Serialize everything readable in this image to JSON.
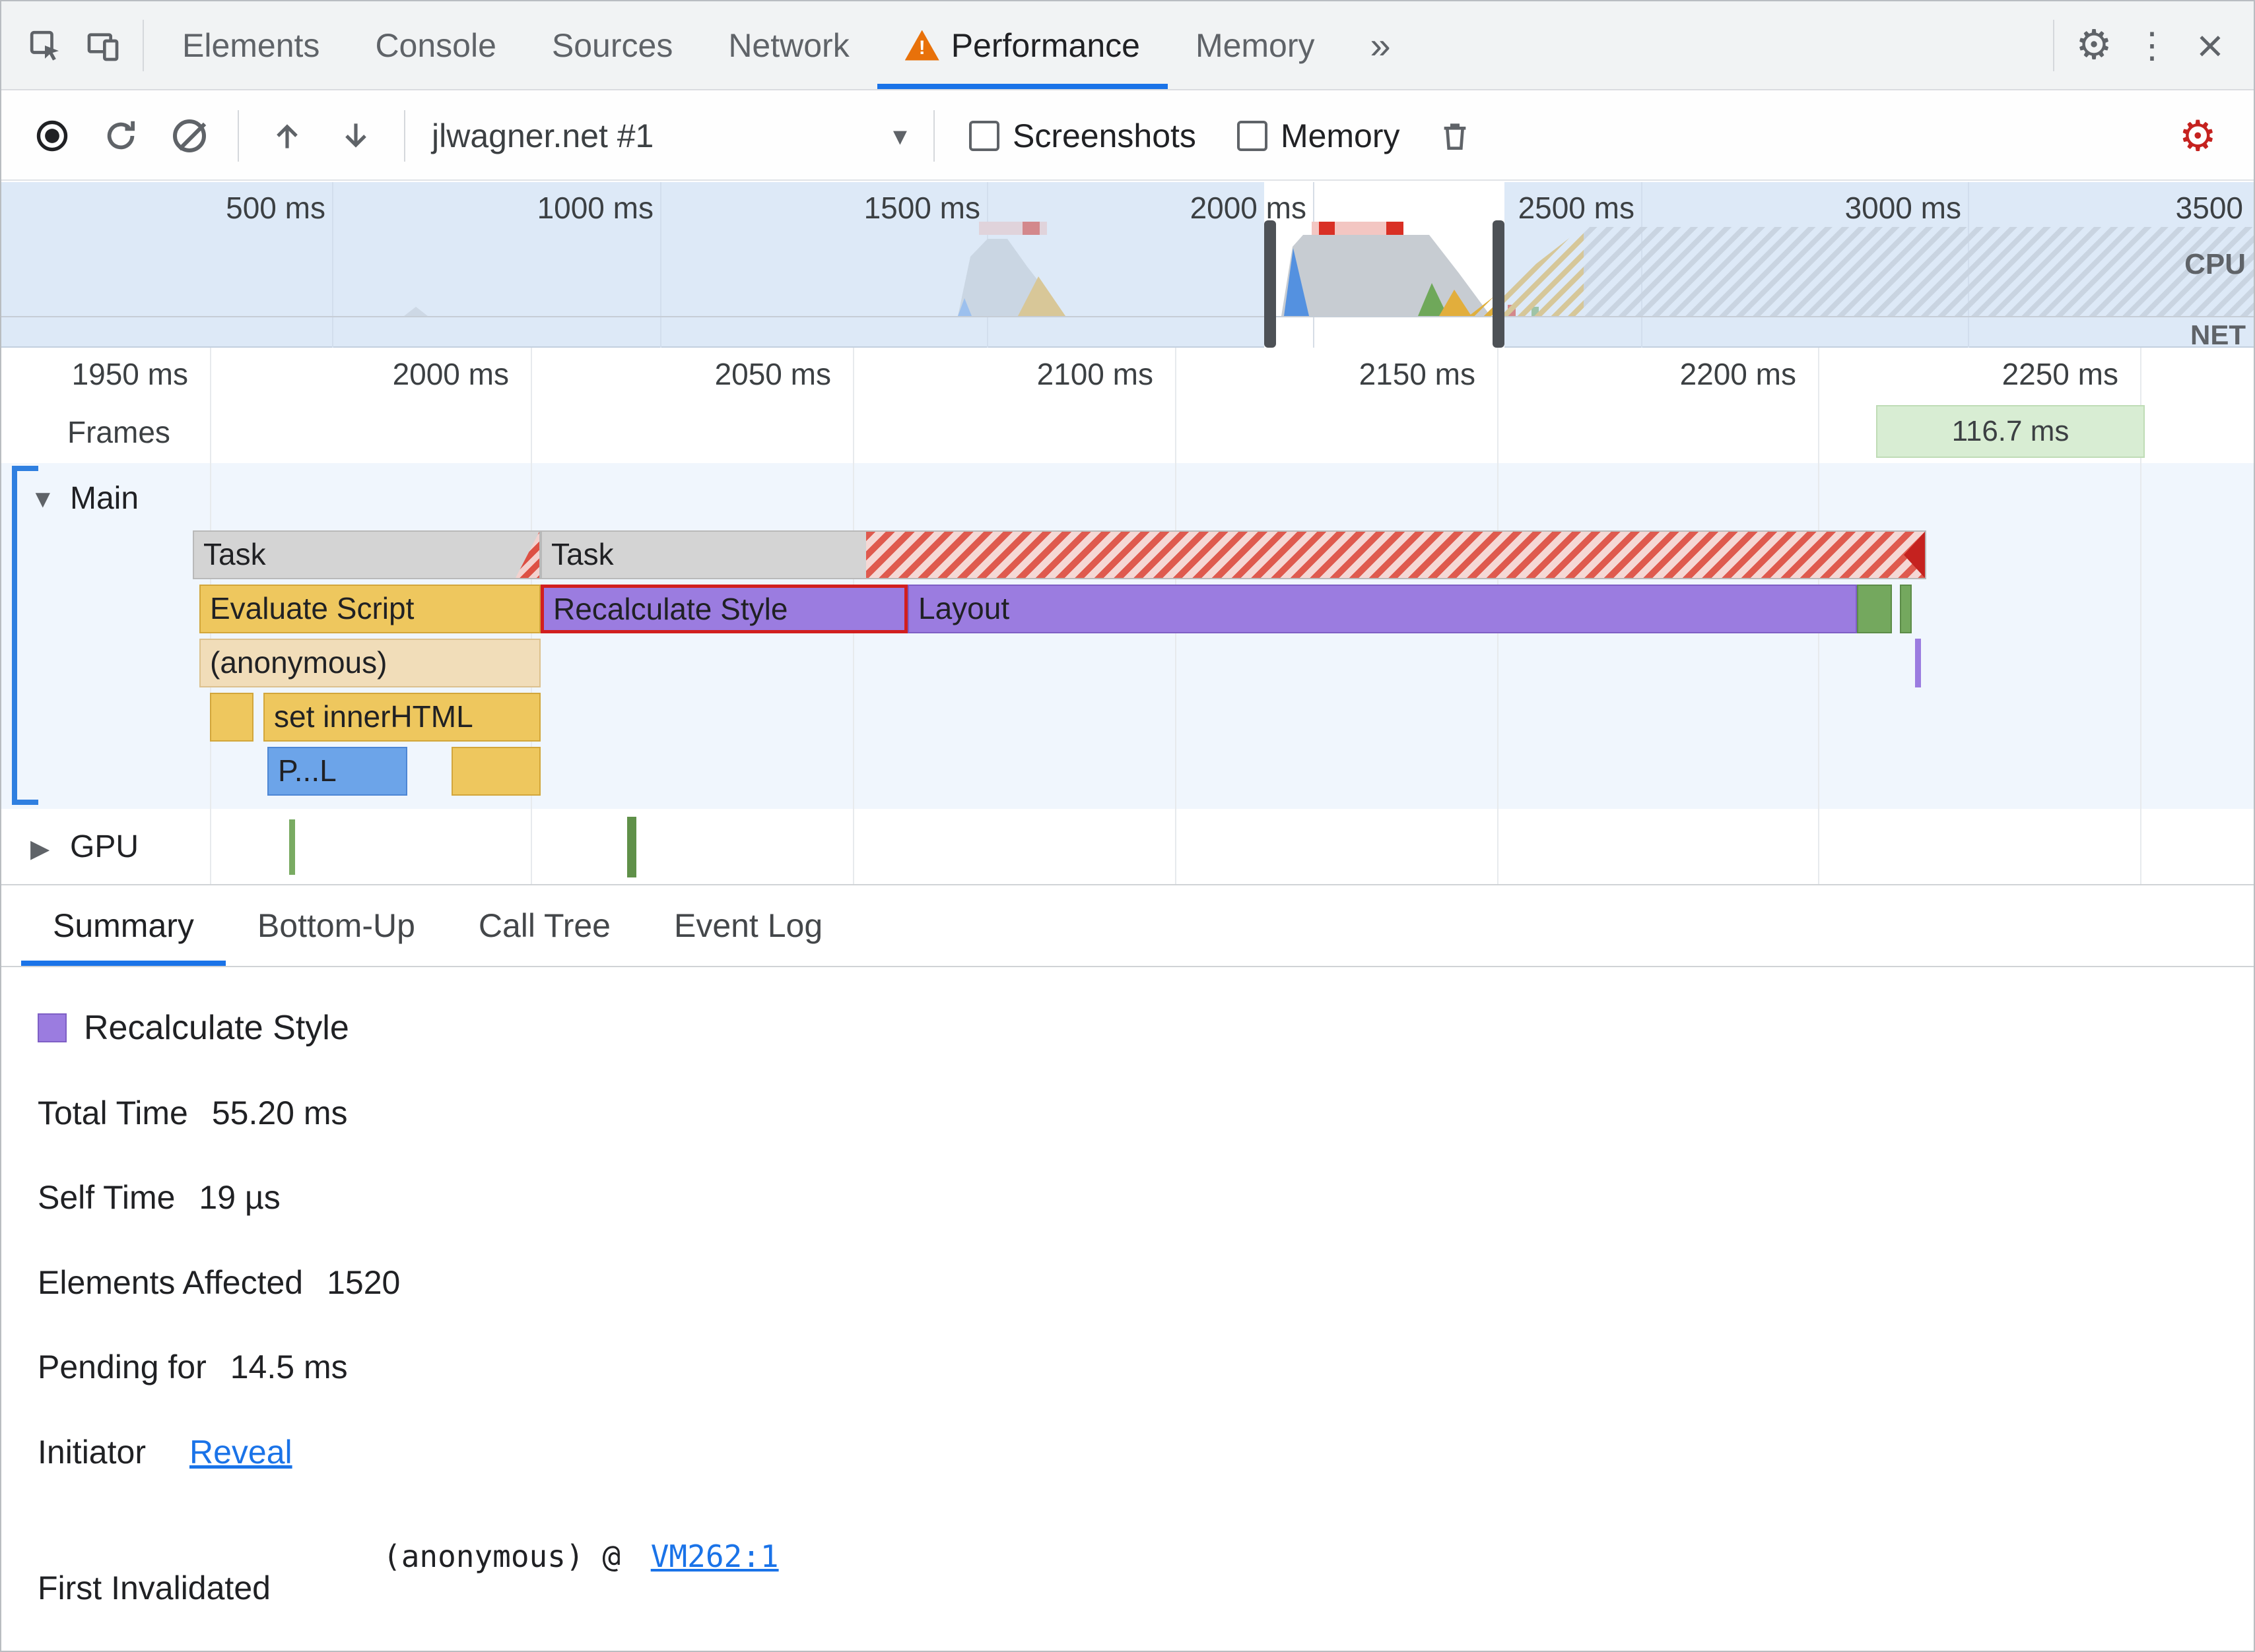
{
  "tab_bar": {
    "tabs": [
      {
        "label": "Elements"
      },
      {
        "label": "Console"
      },
      {
        "label": "Sources"
      },
      {
        "label": "Network"
      },
      {
        "label": "Performance"
      },
      {
        "label": "Memory"
      }
    ],
    "active_tab": "Performance"
  },
  "icons": {
    "more_tabs": "»",
    "dropdown": "▾",
    "kebab": "⋮",
    "close": "×",
    "gear": "⚙",
    "red_gear": "⚙",
    "warning_mark": "!",
    "main_expander": "▼",
    "gpu_expander": "▶"
  },
  "toolbar": {
    "profile_name": "jlwagner.net #1",
    "screenshots_label": "Screenshots",
    "memory_label": "Memory"
  },
  "overview": {
    "time_labels": [
      "500 ms",
      "1000 ms",
      "1500 ms",
      "2000 ms",
      "2500 ms",
      "3000 ms",
      "3500"
    ],
    "cpu_label": "CPU",
    "net_label": "NET"
  },
  "timeline": {
    "ruler_labels": [
      "1950 ms",
      "2000 ms",
      "2050 ms",
      "2100 ms",
      "2150 ms",
      "2200 ms",
      "2250 ms"
    ],
    "frames_label": "Frames",
    "frame_duration": "116.7 ms",
    "main_label": "Main",
    "gpu_label": "GPU",
    "bars": {
      "task1": "Task",
      "task2": "Task",
      "evaluate_script": "Evaluate Script",
      "recalculate_style": "Recalculate Style",
      "layout": "Layout",
      "anonymous": "(anonymous)",
      "set_inner_html": "set innerHTML",
      "parse_html": "P...L"
    }
  },
  "drawer": {
    "tabs": [
      {
        "label": "Summary"
      },
      {
        "label": "Bottom-Up"
      },
      {
        "label": "Call Tree"
      },
      {
        "label": "Event Log"
      }
    ],
    "active_tab": "Summary"
  },
  "summary": {
    "title": "Recalculate Style",
    "rows": [
      {
        "label": "Total Time",
        "value": "55.20 ms"
      },
      {
        "label": "Self Time",
        "value": "19 µs"
      },
      {
        "label": "Elements Affected",
        "value": "1520"
      },
      {
        "label": "Pending for",
        "value": "14.5 ms"
      }
    ],
    "initiator": {
      "label": "Initiator",
      "link": "Reveal"
    },
    "first_invalidated": {
      "label": "First Invalidated",
      "value": "(anonymous) @",
      "link": "VM262:1"
    }
  },
  "colors": {
    "accent": "#1a73e8",
    "scripting_yellow": "#eec75e",
    "rendering_purple": "#9b7ce0",
    "painting_green": "#74a85e",
    "loading_blue": "#6ca4e9",
    "long_task_red": "#d93025",
    "frame_green": "#d8edd3"
  }
}
